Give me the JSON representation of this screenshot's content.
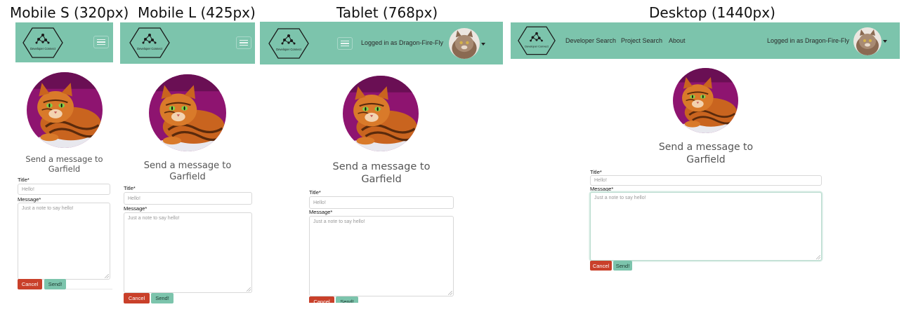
{
  "panels": [
    {
      "id": "mobile_s",
      "title": "Mobile S (320px)"
    },
    {
      "id": "mobile_l",
      "title": "Mobile L (425px)"
    },
    {
      "id": "tablet",
      "title": "Tablet (768px)"
    },
    {
      "id": "desktop",
      "title": "Desktop (1440px)"
    }
  ],
  "app": {
    "logo_text": "Developer Connect",
    "logged_in_text": "Logged in as Dragon-Fire-Fly",
    "nav_links": [
      "Developer Search",
      "Project Search",
      "About"
    ]
  },
  "form": {
    "heading_line1": "Send a message to",
    "heading_line2": "Garfield",
    "title_label": "Title*",
    "title_placeholder": "Hello!",
    "message_label": "Message*",
    "message_placeholder": "Just a note to say hello!",
    "cancel_label": "Cancel",
    "send_label": "Send!"
  },
  "icons": {
    "logo": "network-hexagon-logo-icon",
    "menu": "hamburger-menu-icon",
    "dropdown": "caret-down-icon"
  },
  "colors": {
    "navbar": "#7cc4ac",
    "cancel": "#c9402a",
    "send": "#7cc4ac"
  }
}
